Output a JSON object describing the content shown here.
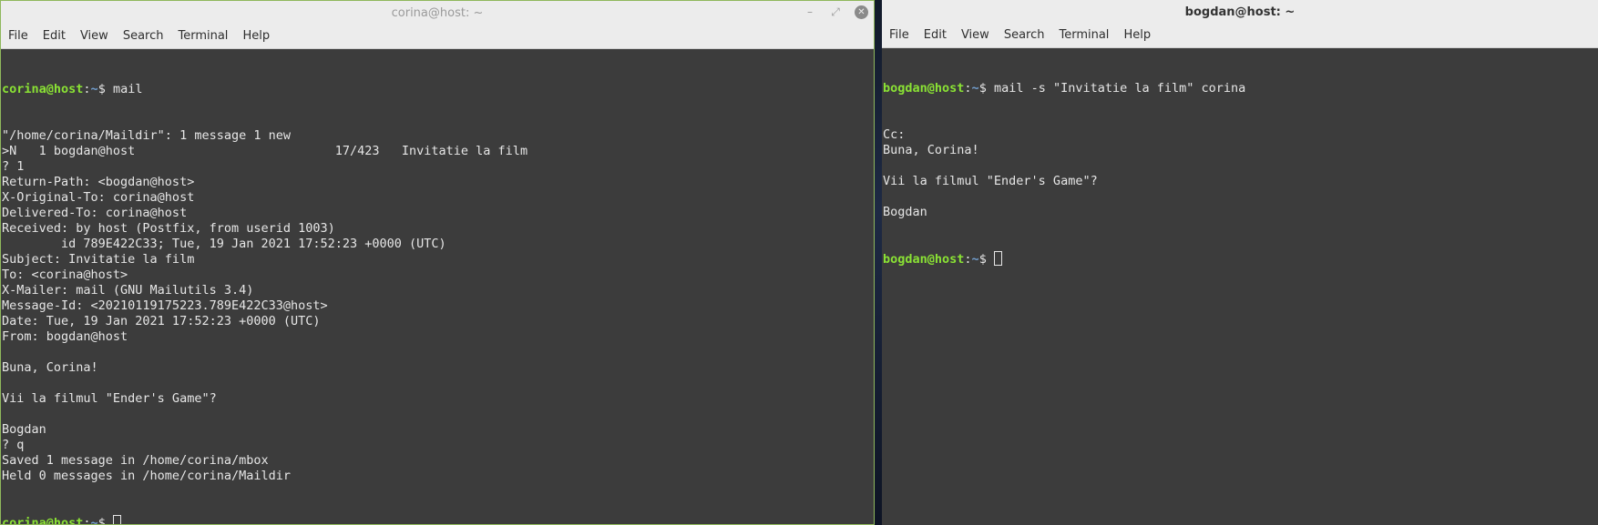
{
  "menu": [
    "File",
    "Edit",
    "View",
    "Search",
    "Terminal",
    "Help"
  ],
  "left": {
    "title": "corina@host: ~",
    "controls": {
      "minimize": "–",
      "maximize": "⤢",
      "close": "✕"
    },
    "prompt": {
      "user": "corina@host",
      "sep": ":",
      "path": "~",
      "sym": "$ "
    },
    "command": "mail",
    "output": [
      "\"/home/corina/Maildir\": 1 message 1 new",
      ">N   1 bogdan@host                           17/423   Invitatie la film",
      "? 1",
      "Return-Path: <bogdan@host>",
      "X-Original-To: corina@host",
      "Delivered-To: corina@host",
      "Received: by host (Postfix, from userid 1003)",
      "        id 789E422C33; Tue, 19 Jan 2021 17:52:23 +0000 (UTC)",
      "Subject: Invitatie la film",
      "To: <corina@host>",
      "X-Mailer: mail (GNU Mailutils 3.4)",
      "Message-Id: <20210119175223.789E422C33@host>",
      "Date: Tue, 19 Jan 2021 17:52:23 +0000 (UTC)",
      "From: bogdan@host",
      "",
      "Buna, Corina!",
      "",
      "Vii la filmul \"Ender's Game\"?",
      "",
      "Bogdan",
      "? q",
      "Saved 1 message in /home/corina/mbox",
      "Held 0 messages in /home/corina/Maildir"
    ]
  },
  "right": {
    "title": "bogdan@host: ~",
    "prompt": {
      "user": "bogdan@host",
      "sep": ":",
      "path": "~",
      "sym": "$ "
    },
    "command": "mail -s \"Invitatie la film\" corina",
    "output": [
      "Cc:",
      "Buna, Corina!",
      "",
      "Vii la filmul \"Ender's Game\"?",
      "",
      "Bogdan"
    ]
  },
  "colors": {
    "terminal_bg": "#3c3c3c",
    "terminal_fg": "#e6e6e6",
    "prompt_user": "#8ae234",
    "prompt_path": "#729fcf",
    "titlebar_bg": "#ececec"
  }
}
